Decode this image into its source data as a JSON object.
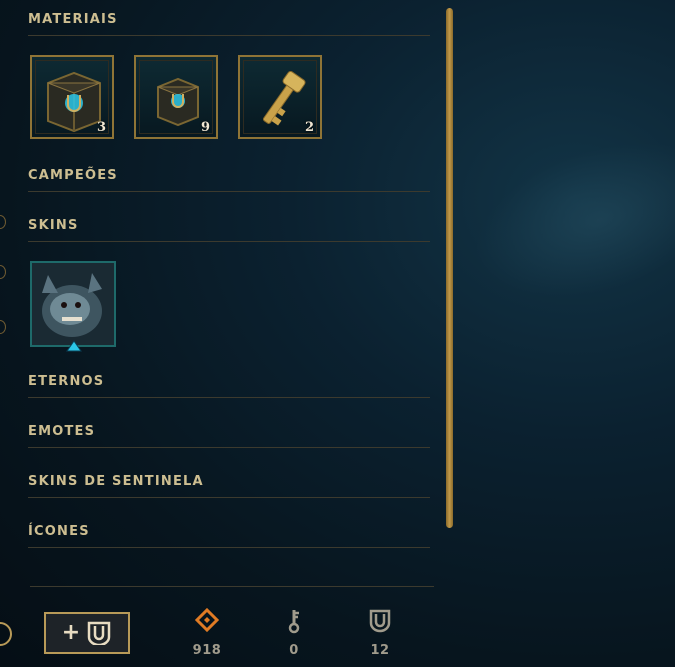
{
  "sections": {
    "materiais": "MATERIAIS",
    "campeoes": "CAMPEÕES",
    "skins": "SKINS",
    "eternos": "ETERNOS",
    "emotes": "EMOTES",
    "sentinela": "SKINS DE SENTINELA",
    "icones": "ÍCONES"
  },
  "materials": [
    {
      "name": "hextech-chest",
      "count": "3"
    },
    {
      "name": "hextech-chest-small",
      "count": "9"
    },
    {
      "name": "hextech-key",
      "count": "2"
    }
  ],
  "currencies": {
    "orange_essence": "918",
    "key_fragments": "0",
    "chests": "12"
  },
  "colors": {
    "gold": "#c8aa6e",
    "text": "#cdbe91",
    "orange": "#e07b24",
    "hextech_blue": "#2bc7e8"
  }
}
